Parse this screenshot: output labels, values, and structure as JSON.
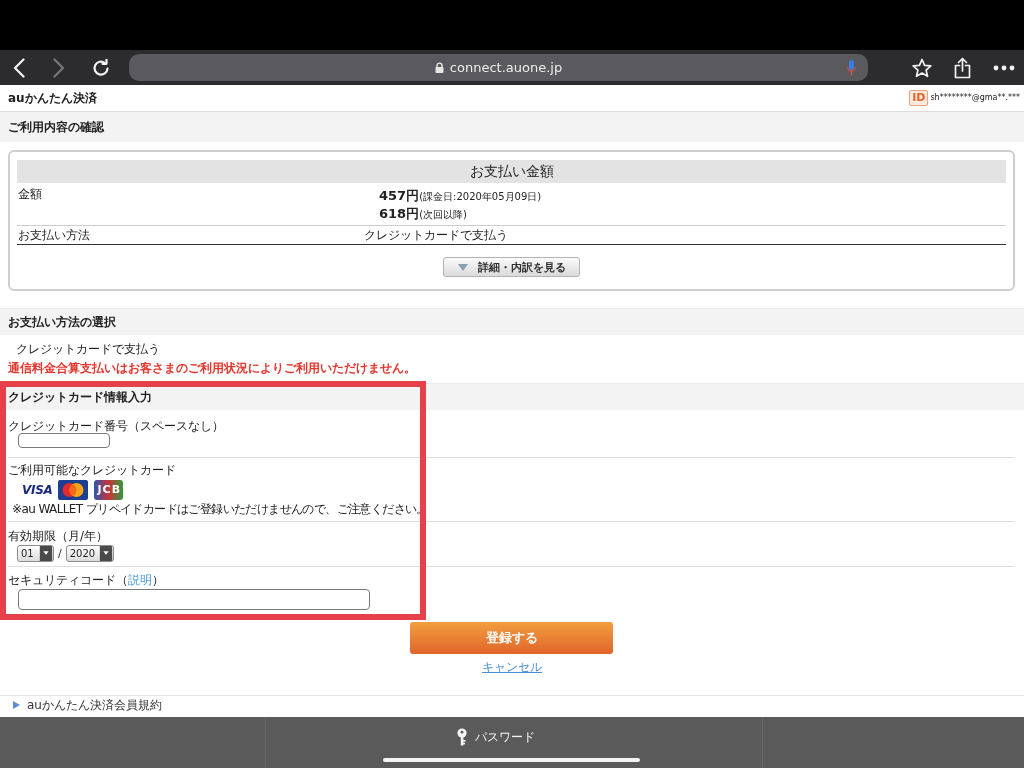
{
  "browser": {
    "nav_buttons": [
      {
        "kind": "back",
        "disabled": false
      },
      {
        "kind": "forward",
        "disabled": true
      },
      {
        "kind": "reload",
        "disabled": false
      }
    ],
    "url": "connect.auone.jp",
    "actions": [
      {
        "kind": "bookmark"
      },
      {
        "kind": "share"
      },
      {
        "kind": "more"
      }
    ]
  },
  "header": {
    "logo": "auかんたん決済",
    "id_badge": "ID",
    "account": "sh********@gma**.***"
  },
  "confirmation": {
    "heading": "ご利用内容の確認",
    "title": "お支払い金額",
    "amount_label": "金額",
    "amounts": [
      {
        "value": "457円",
        "note": "(課金日:2020年05月09日)"
      },
      {
        "value": "618円",
        "note": "(次回以降)"
      }
    ],
    "method_label": "お支払い方法",
    "method_value": "クレジットカードで支払う",
    "details_button": "詳細・内訳を見る"
  },
  "payment_method": {
    "heading": "お支払い方法の選択",
    "option": "クレジットカードで支払う",
    "warning": "通信料金合算支払いはお客さまのご利用状況によりご利用いただけません。"
  },
  "card_form": {
    "highlighted": true,
    "heading": "クレジットカード情報入力",
    "card_number_label": "クレジットカード番号（スペースなし）",
    "brands_label": "ご利用可能なクレジットカード",
    "brands": [
      {
        "kind": "visa",
        "label": "VISA"
      },
      {
        "kind": "mastercard"
      },
      {
        "kind": "jcb",
        "label": "JCB"
      }
    ],
    "brands_note": "※au WALLET プリペイドカードはご登録いただけませんので、ご注意ください。",
    "expiry_label": "有効期限（月/年）",
    "expiry_month": "01",
    "expiry_separator": "/",
    "expiry_year": "2020",
    "security_label": {
      "text": "セキュリティコード（",
      "link": "説明",
      "end": "）"
    }
  },
  "submit_button": "登録する",
  "cancel_link": "キャンセル",
  "footer_links": [
    "auかんたん決済会員規約"
  ],
  "bottom_bar": {
    "items": [
      {
        "kind": "password",
        "label": "パスワード"
      }
    ]
  }
}
